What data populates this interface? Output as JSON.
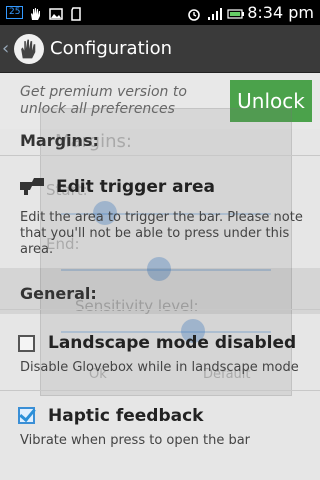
{
  "status_bar": {
    "notification_badge": "25",
    "icons": [
      "glove-icon",
      "image-icon",
      "sd-card-icon",
      "alarm-icon",
      "signal-icon",
      "battery-icon"
    ],
    "time": "8:34 pm"
  },
  "action_bar": {
    "title": "Configuration",
    "back_icon": "chevron-left-icon",
    "logo_icon": "glove-logo-icon"
  },
  "premium": {
    "text": "Get premium version to unlock all preferences",
    "button_label": "Unlock",
    "button_color": "#4ba24b"
  },
  "sections": {
    "margins": "Margins:",
    "general": "General:"
  },
  "prefs": {
    "edit_trigger": {
      "title": "Edit trigger area",
      "summary": "Edit the area to trigger the bar. Please note that you'll not be able to press under this area."
    },
    "landscape": {
      "title": "Landscape mode disabled",
      "summary": "Disable Glovebox while in landscape mode",
      "checked": false
    },
    "haptic": {
      "title": "Haptic feedback",
      "summary": "Vibrate when press to open the bar",
      "checked": true
    }
  },
  "ghost_dialog": {
    "title": "Margins:",
    "start_label": "Start:",
    "end_label": "End:",
    "sensitivity_label": "Sensitivity level:",
    "ok_label": "Ok",
    "default_label": "Default"
  }
}
